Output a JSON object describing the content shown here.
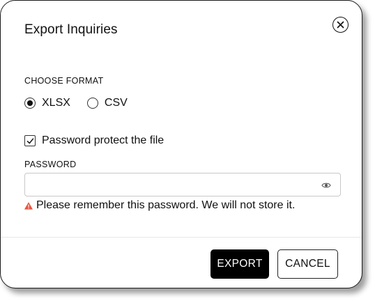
{
  "dialog": {
    "title": "Export Inquiries"
  },
  "format": {
    "label": "CHOOSE FORMAT",
    "options": [
      {
        "label": "XLSX",
        "selected": true
      },
      {
        "label": "CSV",
        "selected": false
      }
    ]
  },
  "protect": {
    "label": "Password protect the file",
    "checked": true
  },
  "password": {
    "label": "PASSWORD",
    "value": "",
    "placeholder": ""
  },
  "warning": {
    "text": "Please remember this password. We will not store it.",
    "icon_color": "#e8573f"
  },
  "actions": {
    "export_label": "EXPORT",
    "cancel_label": "CANCEL"
  },
  "icons": {
    "close": "close-circle-icon",
    "eye": "eye-icon",
    "warning": "warning-triangle-icon",
    "check": "checkmark-icon"
  }
}
